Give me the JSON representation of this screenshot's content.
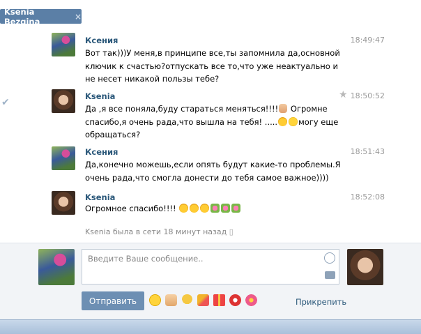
{
  "tab": {
    "title": "Ksenia Bezgina",
    "close_icon": "×"
  },
  "messages": [
    {
      "author": "Ксения",
      "time": "18:49:47",
      "text": "Вот так)))У меня,в принципе все,ты запомнила да,основной ключик к счастью?отпускать все то,что уже неактуально и не несет никакой пользы тебе?"
    },
    {
      "author": "Ksenia",
      "time": "18:50:52",
      "text_a": "Да ,я все поняла,буду стараться меняться!!!!",
      "text_b": " Огромне спасибо,я очень рада,что вышла на тебя! .....",
      "text_c": "могу еще обращаться?"
    },
    {
      "author": "Ксения",
      "time": "18:51:43",
      "text": "Да,конечно можешь,если опять будут какие-то проблемы.Я очень рада,что смогла донести до тебя самое важное))))"
    },
    {
      "author": "Ksenia",
      "time": "18:52:08",
      "text": "Огромное спасибо!!!! "
    }
  ],
  "status": "Ksenia была в сети 18 минут назад",
  "composer": {
    "placeholder": "Введите Ваше сообщение..",
    "send_label": "Отправить",
    "attach_label": "Прикрепить"
  },
  "colors": {
    "link": "#2b587a",
    "send_button": "#6d8fb3",
    "tab_chip": "#5b7fa6"
  }
}
